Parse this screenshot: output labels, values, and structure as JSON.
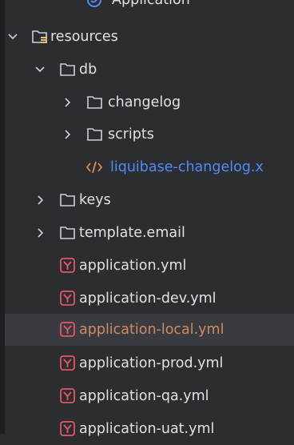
{
  "colors": {
    "background": "#2b2d30",
    "selected_row": "#393b40",
    "text": "#dfe1e5",
    "folder_icon": "#ced0d6",
    "yaml_icon": "#e55765",
    "xml_icon": "#e08855",
    "link_text": "#548af7",
    "modified_text": "#d08b62"
  },
  "tree": {
    "top_partial": {
      "label": "Application",
      "icon": "spring-boot-icon"
    },
    "items": [
      {
        "label": "resources",
        "icon": "resources-folder-icon",
        "chevron": "chevron-down-icon"
      },
      {
        "label": "db",
        "icon": "folder-icon",
        "chevron": "chevron-down-icon"
      },
      {
        "label": "changelog",
        "icon": "folder-icon",
        "chevron": "chevron-right-icon"
      },
      {
        "label": "scripts",
        "icon": "folder-icon",
        "chevron": "chevron-right-icon"
      },
      {
        "label": "liquibase-changelog.x",
        "icon": "xml-file-icon"
      },
      {
        "label": "keys",
        "icon": "folder-icon",
        "chevron": "chevron-right-icon"
      },
      {
        "label": "template.email",
        "icon": "folder-icon",
        "chevron": "chevron-right-icon"
      },
      {
        "label": "application.yml",
        "icon": "yaml-file-icon"
      },
      {
        "label": "application-dev.yml",
        "icon": "yaml-file-icon"
      },
      {
        "label": "application-local.yml",
        "icon": "yaml-file-icon",
        "selected": true
      },
      {
        "label": "application-prod.yml",
        "icon": "yaml-file-icon"
      },
      {
        "label": "application-qa.yml",
        "icon": "yaml-file-icon"
      },
      {
        "label": "application-uat.yml",
        "icon": "yaml-file-icon"
      }
    ]
  }
}
